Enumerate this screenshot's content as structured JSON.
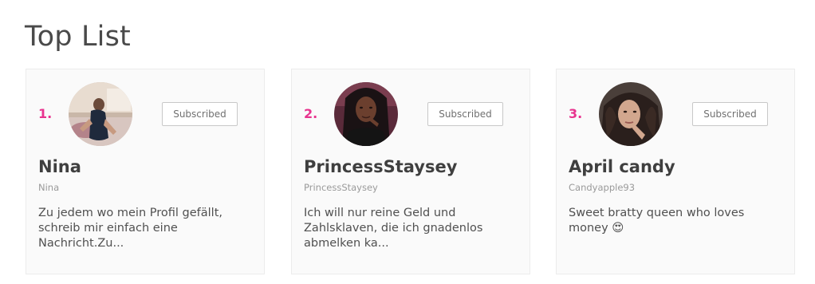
{
  "page": {
    "title": "Top List"
  },
  "colors": {
    "rank_accent": "#e8348f",
    "card_background": "#fafafa",
    "button_border": "#c8c8c8"
  },
  "cards": [
    {
      "rank": "1.",
      "avatar_icon": "profile-photo",
      "subscribe_label": "Subscribed",
      "display_name": "Nina",
      "username": "Nina",
      "description": "Zu jedem wo mein Profil gefällt, schreib mir einfach eine Nachricht.Zu..."
    },
    {
      "rank": "2.",
      "avatar_icon": "profile-photo",
      "subscribe_label": "Subscribed",
      "display_name": "PrincessStaysey",
      "username": "PrincessStaysey",
      "description": "Ich will nur reine Geld und Zahlsklaven, die ich gnadenlos abmelken ka..."
    },
    {
      "rank": "3.",
      "avatar_icon": "profile-photo",
      "subscribe_label": "Subscribed",
      "display_name": "April candy",
      "username": "Candyapple93",
      "description": "Sweet bratty queen who loves money 😍"
    }
  ]
}
